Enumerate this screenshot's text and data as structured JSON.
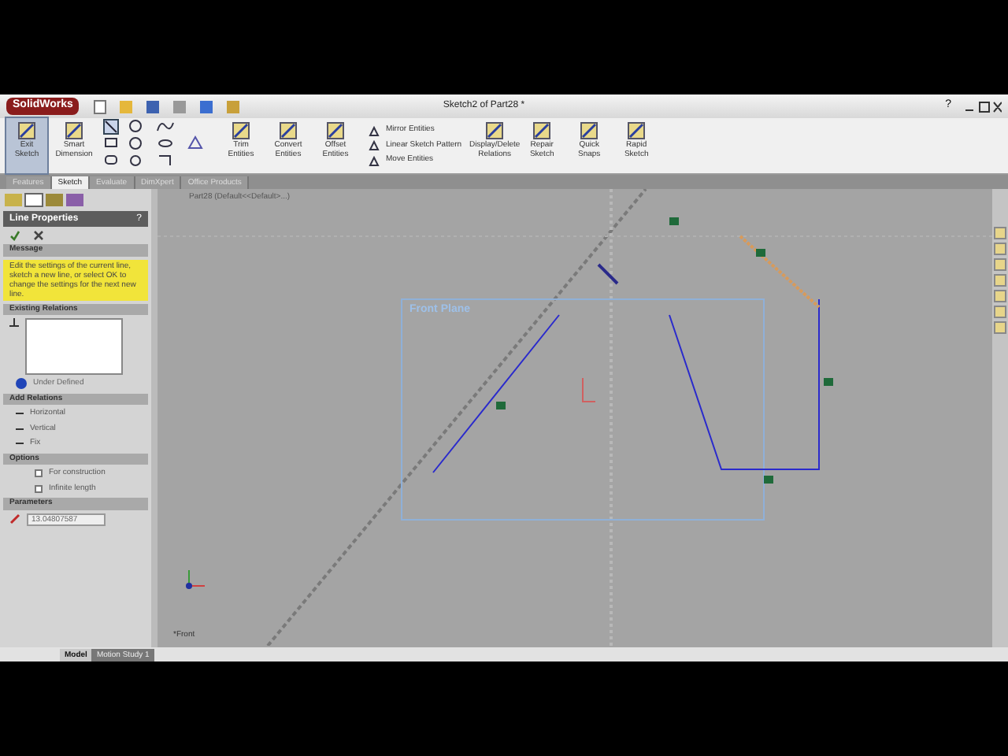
{
  "title_bar": {
    "logo": "SolidWorks",
    "title": "Sketch2 of Part28 *",
    "help": "?"
  },
  "ribbon": {
    "groups": [
      {
        "kind": "big",
        "label": "Exit Sketch",
        "selected": true
      },
      {
        "kind": "big",
        "label": "Smart Dimension",
        "selected": false
      },
      {
        "kind": "grid"
      },
      {
        "kind": "big",
        "label": "Trim Entities",
        "selected": false
      },
      {
        "kind": "big",
        "label": "Convert Entities",
        "selected": false
      },
      {
        "kind": "big",
        "label": "Offset Entities",
        "selected": false
      },
      {
        "kind": "list",
        "items": [
          "Mirror Entities",
          "Linear Sketch Pattern",
          "Move Entities"
        ]
      },
      {
        "kind": "big",
        "label": "Display/Delete Relations",
        "selected": false
      },
      {
        "kind": "big",
        "label": "Repair Sketch",
        "selected": false
      },
      {
        "kind": "big",
        "label": "Quick Snaps",
        "selected": false
      },
      {
        "kind": "big",
        "label": "Rapid Sketch",
        "selected": false
      }
    ]
  },
  "tabs": [
    {
      "label": "Features",
      "selected": false
    },
    {
      "label": "Sketch",
      "selected": true
    },
    {
      "label": "Evaluate",
      "selected": false
    },
    {
      "label": "DimXpert",
      "selected": false
    },
    {
      "label": "Office Products",
      "selected": false
    }
  ],
  "property_manager": {
    "title": "Line Properties",
    "help": "?",
    "message": {
      "title": "Message",
      "text": "Edit the settings of the current line, sketch a new line, or select OK to change the settings for the next new line."
    },
    "existing_relations": {
      "title": "Existing Relations",
      "status": "Under Defined"
    },
    "add_relations": {
      "title": "Add Relations",
      "items": [
        "Horizontal",
        "Vertical",
        "Fix"
      ]
    },
    "options": {
      "title": "Options",
      "items": [
        {
          "label": "For construction",
          "checked": false
        },
        {
          "label": "Infinite length",
          "checked": false
        }
      ]
    },
    "parameters": {
      "title": "Parameters",
      "value": "13.04807587"
    }
  },
  "canvas": {
    "tree_label": "Part28 (Default<<Default>...)",
    "plane_label": "Front Plane",
    "view_label": "*Front"
  },
  "bottom_tabs": [
    {
      "label": "Model",
      "selected": true
    },
    {
      "label": "Motion Study 1",
      "selected": false
    }
  ]
}
